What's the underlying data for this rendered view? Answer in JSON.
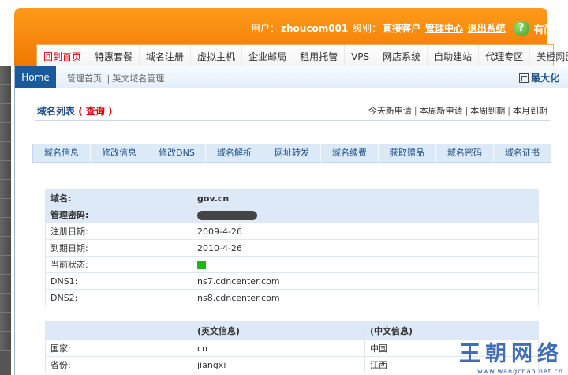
{
  "header": {
    "user_label": "用户：",
    "username": "zhoucom001",
    "level_label": "级别：",
    "level_value": "直接客户",
    "admin_center": "管理中心",
    "logout": "退出系统",
    "help_label": "有问必答"
  },
  "nav": {
    "items": [
      "回到首页",
      "特惠套餐",
      "域名注册",
      "虚拟主机",
      "企业邮局",
      "租用托管",
      "VPS",
      "网店系统",
      "自助建站",
      "代理专区",
      "美橙网盟"
    ]
  },
  "crumbbar": {
    "home": "Home",
    "crumb1": "管理首页",
    "sep": "|",
    "crumb2": "英文域名管理",
    "maximize": "最大化"
  },
  "list": {
    "title": "域名列表",
    "query": "( 查询 )",
    "period_links": [
      "今天新申请",
      "本周新申请",
      "本周到期",
      "本月到期"
    ],
    "pipe": "|"
  },
  "tabs": [
    "域名信息",
    "修改信息",
    "修改DNS",
    "域名解析",
    "网址转发",
    "域名续费",
    "获取赠品",
    "域名密码",
    "域名证书"
  ],
  "domain_info": {
    "rows": [
      {
        "label": "域名:",
        "value": "gov.cn"
      },
      {
        "label": "管理密码:",
        "value": ""
      },
      {
        "label": "注册日期:",
        "value": "2009-4-26"
      },
      {
        "label": "到期日期:",
        "value": "2010-4-26"
      },
      {
        "label": "当前状态:",
        "value": ""
      },
      {
        "label": "DNS1:",
        "value": "ns7.cdncenter.com"
      },
      {
        "label": "DNS2:",
        "value": "ns8.cdncenter.com"
      }
    ],
    "status_color": "#1fb31f"
  },
  "contact_info": {
    "header_en": "(英文信息)",
    "header_cn": "(中文信息)",
    "rows": [
      {
        "label": "国家:",
        "en": "cn",
        "cn": "中国"
      },
      {
        "label": "省份:",
        "en": "jiangxi",
        "cn": "江西"
      }
    ]
  },
  "watermark": {
    "text": "王朝网络",
    "url": "www.wangchao.net.cn"
  },
  "colors": {
    "banner_orange": "#f07800",
    "link_blue": "#1a4e86",
    "home_tab": "#1a5a9a",
    "accent_red": "#e0000f"
  }
}
